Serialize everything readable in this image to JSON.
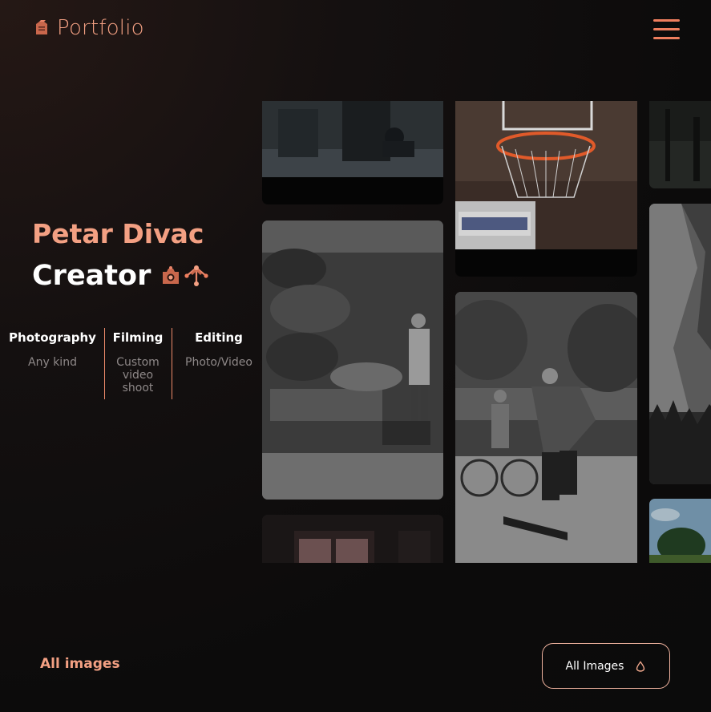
{
  "header": {
    "logo_text": "Portfolio",
    "logo_icon": "briefcase-icon",
    "menu_icon": "hamburger-menu-icon"
  },
  "hero": {
    "name": "Petar Divac",
    "role": "Creator",
    "role_icons": [
      "camera-icon",
      "vector-nodes-icon"
    ]
  },
  "services": [
    {
      "title": "Photography",
      "description": "Any kind"
    },
    {
      "title": "Filming",
      "description": "Custom video shoot"
    },
    {
      "title": "Editing",
      "description": "Photo/Video"
    }
  ],
  "gallery": {
    "images": [
      "street-scene-photo",
      "basketball-hoop-photo",
      "dark-forest-photo",
      "mechanic-workshop-photo",
      "mountain-cliff-photo",
      "skateboarder-jump-photo",
      "window-interior-photo",
      "tree-sky-photo"
    ]
  },
  "footer": {
    "all_images_link": "All images",
    "all_images_button": "All Images",
    "button_icon": "droplet-icon"
  },
  "colors": {
    "accent": "#f3a083",
    "accent_strong": "#ef7e5e",
    "background": "#0b0b0b",
    "muted_text": "#8e8888"
  }
}
